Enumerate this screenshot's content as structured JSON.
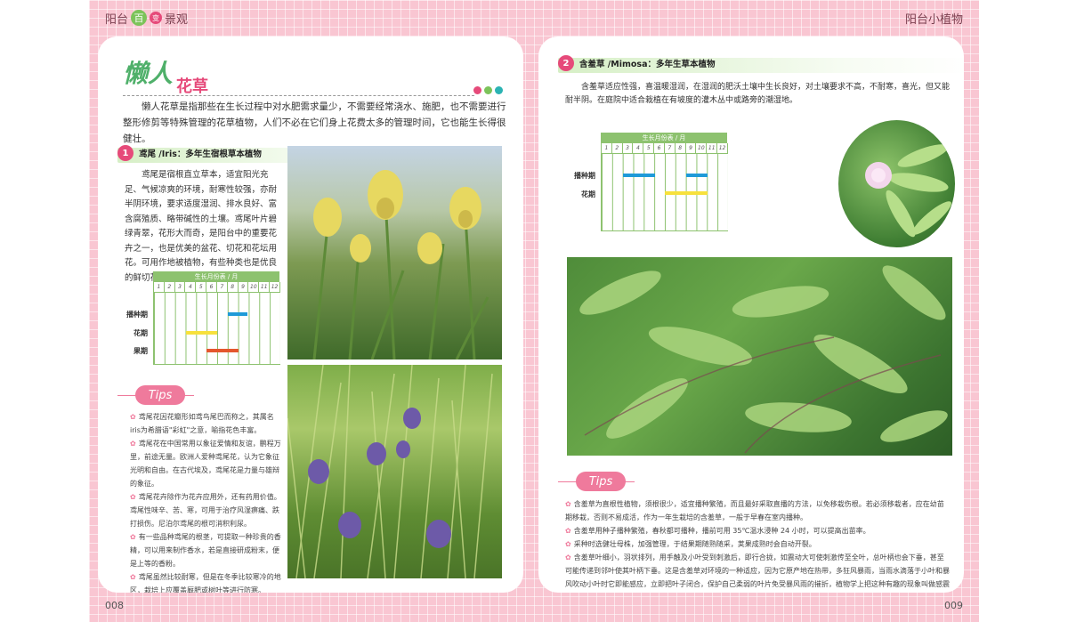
{
  "header": {
    "left_a": "阳台",
    "left_badge1": "百",
    "left_badge2": "变",
    "left_b": "景观",
    "right": "阳台小植物"
  },
  "folio": {
    "left": "008",
    "right": "009"
  },
  "left_page": {
    "title_a": "懒人",
    "title_b": "花草",
    "intro": "懒人花草是指那些在生长过程中对水肥需求量少，不需要经常浇水、施肥，也不需要进行整形修剪等特殊管理的花草植物，人们不必在它们身上花费太多的管理时间，它也能生长得很健壮。",
    "section": {
      "number": "1",
      "title": "鸢尾 /Iris：多年生宿根草本植物",
      "body": "鸢尾是宿根直立草本，适宜阳光充足、气候凉爽的环境，耐寒性较强，亦耐半阴环境，要求适度湿润、排水良好、富含腐殖质、略带碱性的土壤。鸢尾叶片碧绿青翠，花形大而奇，是阳台中的重要花卉之一，也是优美的盆花、切花和花坛用花。可用作地被植物，有些种类也是优良的鲜切花材料。"
    },
    "calendar": {
      "header": "生长月份表 / 月",
      "months": [
        "1",
        "2",
        "3",
        "4",
        "5",
        "6",
        "7",
        "8",
        "9",
        "10",
        "11",
        "12"
      ],
      "rows": [
        "播种期",
        "花期",
        "果期"
      ]
    },
    "tips": {
      "label": "Tips",
      "items": [
        "鸢尾花因花瓣形如鸢鸟尾巴而称之，其属名iris为希腊语\"彩虹\"之意，喻指花色丰富。",
        "鸢尾花在中国常用以象征爱情和友谊，鹏程万里，前途无量。欧洲人爱种鸢尾花，认为它象征光明和自由。在古代埃及，鸢尾花是力量与雄辩的象征。",
        "鸢尾花卉除作为花卉应用外，还有药用价值。鸢尾性味辛、苦、寒，可用于治疗风湿痹痛、跌打损伤。尼泊尔鸢尾的根可消积利尿。",
        "有一些品种鸢尾的根茎，可提取一种珍贵的香精，可以用来制作香水，若是直接研成粉末，便是上等的香粉。",
        "鸢尾虽然比较耐寒，但是在冬季比较寒冷的地区，栽培上应覆盖厩肥或树叶等进行防寒。"
      ]
    }
  },
  "right_page": {
    "section": {
      "number": "2",
      "title": "含羞草 /Mimosa：多年生草本植物",
      "body": "含羞草适应性强，喜温暖湿润，在湿润的肥沃土壤中生长良好，对土壤要求不高，不耐寒，喜光，但又能耐半阴。在庭院中适合栽植在有坡度的灌木丛中或路旁的潮湿地。"
    },
    "calendar": {
      "header": "生长月份表 / 月",
      "months": [
        "1",
        "2",
        "3",
        "4",
        "5",
        "6",
        "7",
        "8",
        "9",
        "10",
        "11",
        "12"
      ],
      "rows": [
        "播种期",
        "花期"
      ]
    },
    "tips": {
      "label": "Tips",
      "items": [
        "含羞草为直根性植物，须根很少，适宜播种繁殖，而且最好采取直播的方法，以免移栽伤根。若必须移栽者，应在幼苗期移栽，否则不易成活，作为一年生栽培的含羞草，一般于早春在室内播种。",
        "含羞草用种子播种繁殖，春秋都可播种，播前可用 35℃温水浸种 24 小时，可以提高出苗率。",
        "采种时选健壮母株，加强管理，于结果期随熟随采，荚果成熟时会自动开裂。",
        "含羞草叶细小，羽状排列，用手触及小叶受到刺激后，即行合拢，如震动大可使刺激传至全叶，总叶柄也会下垂，甚至可能传递到邻叶使其叶柄下垂。这是含羞草对环境的一种适应，因为它原产地在热带，多狂风暴雨，当雨水滴落于小叶和暴风吹动小叶时它即能感应，立即把叶子闭合，保护自己柔弱的叶片免受暴风雨的摧折，植物学上把这种有趣的现象叫做感震运动。"
      ]
    }
  }
}
